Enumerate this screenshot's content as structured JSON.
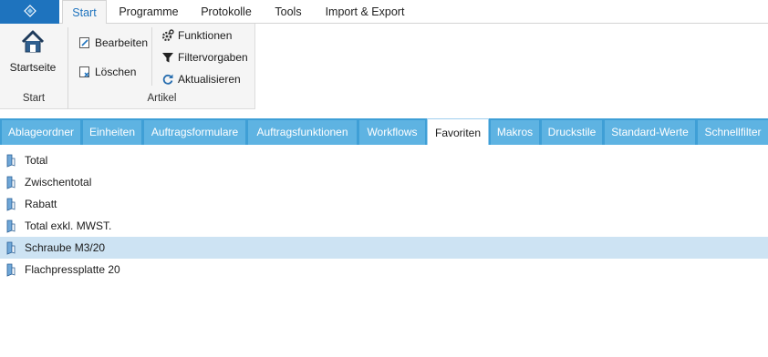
{
  "menu": {
    "tabs": [
      {
        "label": "Start",
        "active": true
      },
      {
        "label": "Programme"
      },
      {
        "label": "Protokolle"
      },
      {
        "label": "Tools"
      },
      {
        "label": "Import & Export"
      }
    ]
  },
  "ribbon": {
    "start_group": {
      "label": "Start",
      "home_button": "Startseite"
    },
    "artikel_group": {
      "label": "Artikel",
      "bearbeiten": "Bearbeiten",
      "loeschen": "Löschen",
      "funktionen": "Funktionen",
      "filtervorgaben": "Filtervorgaben",
      "aktualisieren": "Aktualisieren"
    }
  },
  "tabs": [
    "Ablageordner",
    "Einheiten",
    "Auftragsformulare",
    "Auftragsfunktionen",
    "Workflows",
    "Favoriten",
    "Makros",
    "Druckstile",
    "Standard-Werte",
    "Schnellfilter"
  ],
  "active_tab": "Favoriten",
  "list": {
    "items": [
      "Total",
      "Zwischentotal",
      "Rabatt",
      "Total exkl. MWST.",
      "Schraube M3/20",
      "Flachpressplatte 20"
    ],
    "selected": "Schraube M3/20"
  },
  "colors": {
    "accent": "#1e73be",
    "tabstrip": "#3f9fd6",
    "tab": "#5eb3e2",
    "selection": "#cde3f3"
  }
}
